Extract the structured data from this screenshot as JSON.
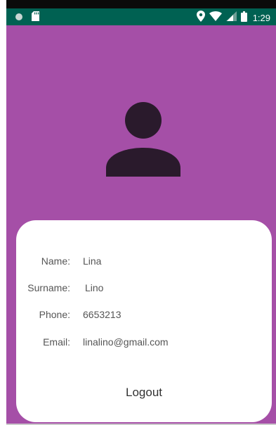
{
  "status_bar": {
    "time": "1:29",
    "icons": [
      "record-icon",
      "sd-card-icon",
      "location-icon",
      "wifi-icon",
      "signal-icon",
      "battery-icon"
    ]
  },
  "colors": {
    "status_bar": "#006152",
    "background": "#a54fa7",
    "avatar": "#2a1a2c",
    "card": "#ffffff"
  },
  "profile": {
    "avatar_icon": "person-icon",
    "fields": {
      "name_label": "Name:",
      "name_value": "Lina",
      "surname_label": "Surname:",
      "surname_value": "Lino",
      "phone_label": "Phone:",
      "phone_value": "6653213",
      "email_label": "Email:",
      "email_value": "linalino@gmail.com"
    },
    "logout_label": "Logout"
  }
}
